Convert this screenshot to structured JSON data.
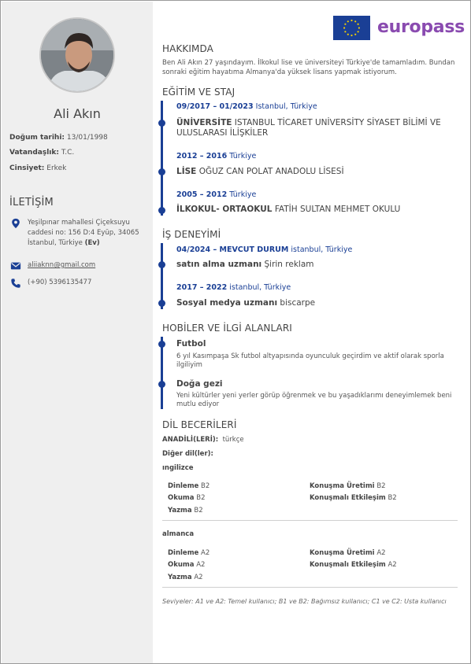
{
  "profile": {
    "name": "Ali Akın",
    "birth_label": "Doğum tarihi:",
    "birth_value": "13/01/1998",
    "citizenship_label": "Vatandaşlık:",
    "citizenship_value": "T.C.",
    "gender_label": "Cinsiyet:",
    "gender_value": "Erkek"
  },
  "contact": {
    "title": "İLETİŞİM",
    "address": "Yeşilpınar mahallesi Çiçeksuyu caddesi no: 156 D:4 Eyüp, 34065 İstanbul, Türkiye",
    "address_tag": "(Ev)",
    "email": "aliiaknn@gmail.com",
    "phone": "(+90) 5396135477"
  },
  "logo": {
    "text": "europass"
  },
  "about": {
    "title": "HAKKIMDA",
    "text": "Ben Ali Akın 27 yaşındayım. İlkokul lise ve üniversiteyi Türkiye'de tamamladım. Bundan sonraki eğitim hayatıma Almanya'da yüksek lisans yapmak istiyorum."
  },
  "education": {
    "title": "EĞİTİM VE STAJ",
    "items": [
      {
        "date": "09/2017 – 01/2023",
        "place": "Istanbul, Türkiye",
        "level": "ÜNİVERSİTE",
        "name": "ISTANBUL TİCARET UNİVERSİTY SİYASET BİLİMİ VE ULUSLARASI İLİŞKİLER"
      },
      {
        "date": "2012 – 2016",
        "place": "Türkiye",
        "level": "LİSE",
        "name": "OĞUZ CAN POLAT ANADOLU LİSESİ"
      },
      {
        "date": "2005 – 2012",
        "place": "Türkiye",
        "level": "İLKOKUL- ORTAOKUL",
        "name": "FATİH SULTAN MEHMET OKULU"
      }
    ]
  },
  "experience": {
    "title": "İŞ DENEYİMİ",
    "items": [
      {
        "date": "04/2024 – MEVCUT DURUM",
        "place": "istanbul, Türkiye",
        "role": "satın alma uzmanı",
        "company": "Şirin reklam"
      },
      {
        "date": "2017 – 2022",
        "place": "istanbul, Türkiye",
        "role": "Sosyal medya uzmanı",
        "company": "biscarpe"
      }
    ]
  },
  "hobbies": {
    "title": "HOBİLER VE İLGİ ALANLARI",
    "items": [
      {
        "name": "Futbol",
        "desc": "6 yıl Kasımpaşa Sk futbol altyapısında oyunculuk geçirdim ve aktif olarak sporla ilgiliyim"
      },
      {
        "name": "Doğa gezi",
        "desc": "Yeni kültürler yeni yerler görüp öğrenmek ve bu yaşadıklarımı deneyimlemek beni mutlu ediyor"
      }
    ]
  },
  "languages": {
    "title": "DİL BECERİLERİ",
    "native_label": "ANADİLİ(LERİ):",
    "native_value": "türkçe",
    "other_label": "Diğer dil(ler):",
    "list": [
      {
        "name": "ıngilizce",
        "listening": "B2",
        "reading": "B2",
        "writing": "B2",
        "spoken_production": "B2",
        "spoken_interaction": "B2"
      },
      {
        "name": "almanca",
        "listening": "A2",
        "reading": "A2",
        "writing": "A2",
        "spoken_production": "A2",
        "spoken_interaction": "A2"
      }
    ],
    "labels": {
      "listening": "Dinleme",
      "reading": "Okuma",
      "writing": "Yazma",
      "spoken_production": "Konuşma Üretimi",
      "spoken_interaction": "Konuşmalı Etkileşim"
    },
    "note": "Seviyeler: A1 ve A2: Temel kullanıcı; B1 ve B2: Bağımsız kullanıcı; C1 ve C2: Usta kullanıcı"
  },
  "colors": {
    "accent": "#1a3f95",
    "sidebar": "#efefef",
    "brand": "#8a4bb0"
  }
}
